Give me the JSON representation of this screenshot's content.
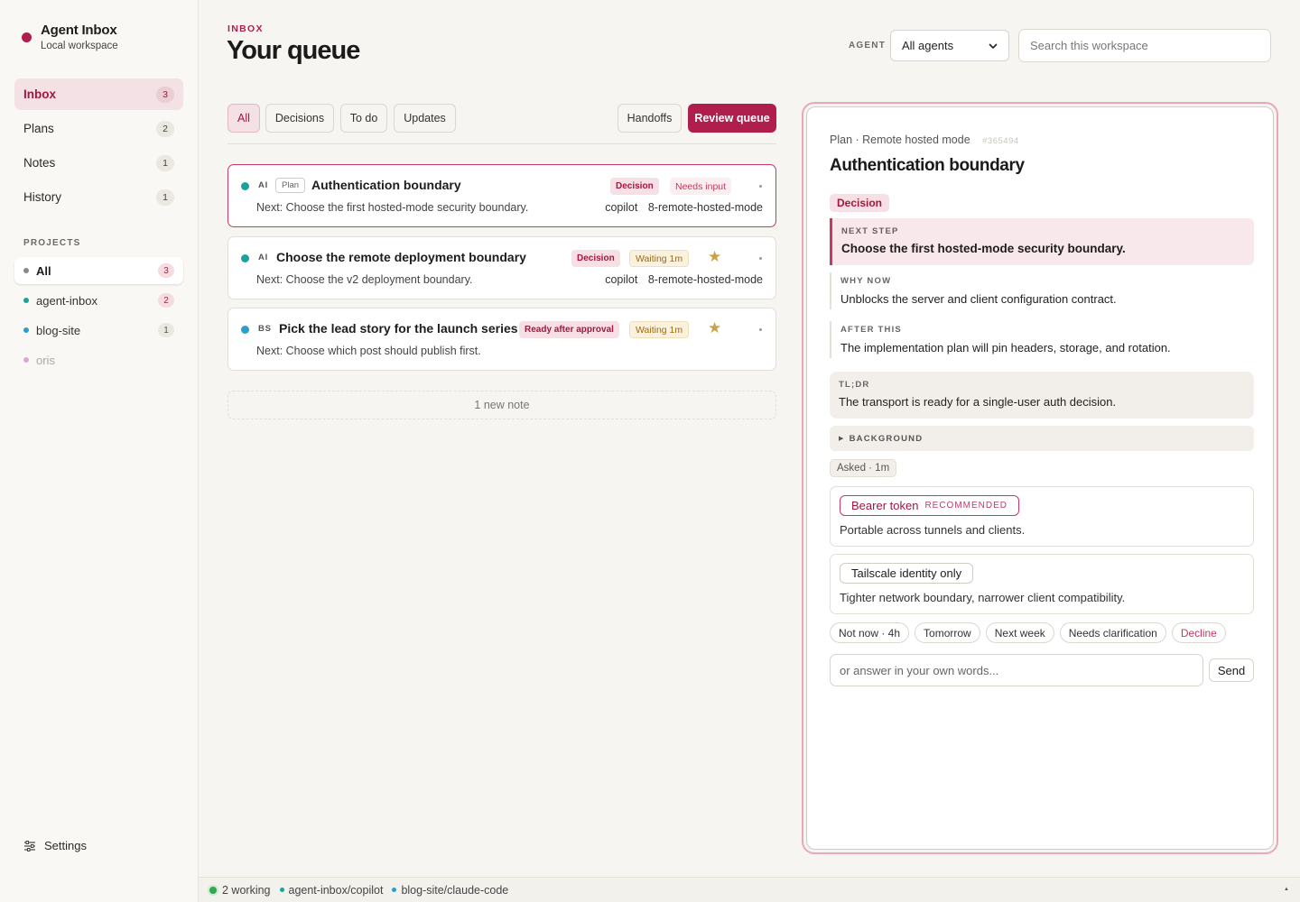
{
  "app": {
    "name": "Agent Inbox",
    "subtitle": "Local workspace",
    "brand_color": "#b01e4d"
  },
  "nav": [
    {
      "label": "Inbox",
      "count": "3",
      "active": true
    },
    {
      "label": "Plans",
      "count": "2"
    },
    {
      "label": "Notes",
      "count": "1"
    },
    {
      "label": "History",
      "count": "1"
    }
  ],
  "projects": {
    "label": "PROJECTS",
    "items": [
      {
        "label": "All",
        "count": "3",
        "dot": "#888888"
      },
      {
        "label": "agent-inbox",
        "count": "2",
        "dot": "#1aa39a"
      },
      {
        "label": "blog-site",
        "count": "1",
        "dot": "#2b9fcc"
      },
      {
        "label": "oris",
        "dot": "#d9a9d6"
      }
    ]
  },
  "settings_label": "Settings",
  "header": {
    "eyebrow": "INBOX",
    "title": "Your queue",
    "agent_label": "AGENT",
    "agent_selected": "All agents",
    "search_placeholder": "Search this workspace"
  },
  "filters": {
    "tabs": [
      "All",
      "Decisions",
      "To do",
      "Updates"
    ],
    "handoffs": "Handoffs",
    "review": "Review queue"
  },
  "queue": [
    {
      "agent": "AI",
      "type": "Plan",
      "title": "Authentication boundary",
      "next": "Next: Choose the first hosted-mode security boundary.",
      "badge1": "Decision",
      "badge2": "Needs input",
      "assignee": "copilot",
      "ref": "8-remote-hosted-mode",
      "dot": "#1aa39a"
    },
    {
      "agent": "AI",
      "title": "Choose the remote deployment boundary",
      "next": "Next: Choose the v2 deployment boundary.",
      "badge1": "Decision",
      "badge2": "Waiting 1m",
      "star": "★",
      "assignee": "copilot",
      "ref": "8-remote-hosted-mode",
      "dot": "#1aa39a"
    },
    {
      "agent": "BS",
      "title": "Pick the lead story for the launch series",
      "next": "Next: Choose which post should publish first.",
      "badge1": "Ready after approval",
      "badge2": "Waiting 1m",
      "star": "★",
      "dot": "#2b9fcc"
    }
  ],
  "new_note": "1 new note",
  "detail": {
    "crumb": "Plan · Remote hosted mode",
    "hash": "#365494",
    "title": "Authentication boundary",
    "badge": "Decision",
    "next_step_label": "NEXT STEP",
    "next_step": "Choose the first hosted-mode security boundary.",
    "why_now_label": "WHY NOW",
    "why_now": "Unblocks the server and client configuration contract.",
    "after_this_label": "AFTER THIS",
    "after_this": "The implementation plan will pin headers, storage, and rotation.",
    "tldr_label": "TL;DR",
    "tldr": "The transport is ready for a single-user auth decision.",
    "background_label": "BACKGROUND",
    "asked": "Asked · 1m",
    "options": [
      {
        "label": "Bearer token",
        "tag": "RECOMMENDED",
        "desc": "Portable across tunnels and clients."
      },
      {
        "label": "Tailscale identity only",
        "desc": "Tighter network boundary, narrower client compatibility."
      }
    ],
    "quick_actions": [
      "Not now · 4h",
      "Tomorrow",
      "Next week",
      "Needs clarification",
      "Decline"
    ],
    "answer_placeholder": "or answer in your own words...",
    "send": "Send"
  },
  "statusbar": {
    "working": "2 working",
    "items": [
      "agent-inbox/copilot",
      "blog-site/claude-code"
    ]
  }
}
